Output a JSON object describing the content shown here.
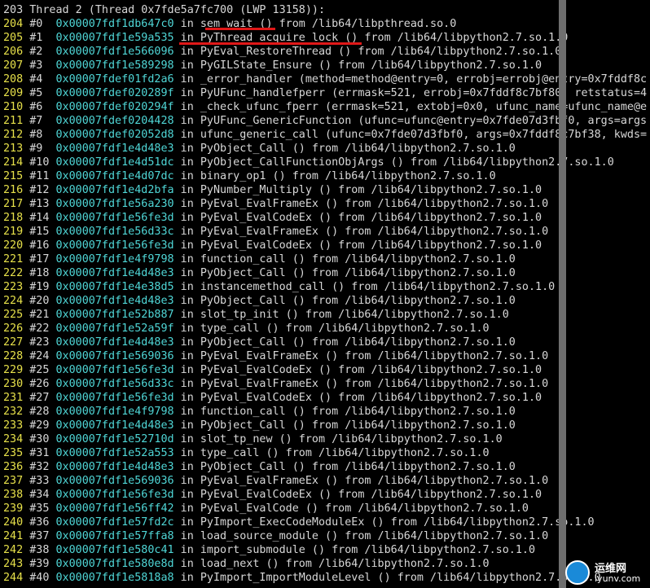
{
  "header": "203 Thread 2 (Thread 0x7fde5a7fc700 (LWP 13158)):",
  "frames": [
    {
      "ln": "204",
      "num": "#0 ",
      "addr": "0x00007fdf1db647c0",
      "rest": " in sem_wait () from /lib64/libpthread.so.0"
    },
    {
      "ln": "205",
      "num": "#1 ",
      "addr": "0x00007fdf1e59a535",
      "rest": " in PyThread_acquire_lock () from /lib64/libpython2.7.so.1.0"
    },
    {
      "ln": "206",
      "num": "#2 ",
      "addr": "0x00007fdf1e566096",
      "rest": " in PyEval_RestoreThread () from /lib64/libpython2.7.so.1.0"
    },
    {
      "ln": "207",
      "num": "#3 ",
      "addr": "0x00007fdf1e589298",
      "rest": " in PyGILState_Ensure () from /lib64/libpython2.7.so.1.0"
    },
    {
      "ln": "208",
      "num": "#4 ",
      "addr": "0x00007fdef01fd2a6",
      "rest": " in _error_handler (method=method@entry=0, errobj=errobj@entry=0x7fddf8c7"
    },
    {
      "ln": "209",
      "num": "#5 ",
      "addr": "0x00007fdef020289f",
      "rest": " in PyUFunc_handlefperr (errmask=521, errobj=0x7fddf8c7bf80, retstatus=4,"
    },
    {
      "ln": "210",
      "num": "#6 ",
      "addr": "0x00007fdef020294f",
      "rest": " in _check_ufunc_fperr (errmask=521, extobj=0x0, ufunc_name=ufunc_name@en"
    },
    {
      "ln": "211",
      "num": "#7 ",
      "addr": "0x00007fdef0204428",
      "rest": " in PyUFunc_GenericFunction (ufunc=ufunc@entry=0x7fde07d3fbf0, args=args@"
    },
    {
      "ln": "212",
      "num": "#8 ",
      "addr": "0x00007fdef02052d8",
      "rest": " in ufunc_generic_call (ufunc=0x7fde07d3fbf0, args=0x7fddf8c7bf38, kwds=0"
    },
    {
      "ln": "213",
      "num": "#9 ",
      "addr": "0x00007fdf1e4d48e3",
      "rest": " in PyObject_Call () from /lib64/libpython2.7.so.1.0"
    },
    {
      "ln": "214",
      "num": "#10",
      "addr": "0x00007fdf1e4d51dc",
      "rest": " in PyObject_CallFunctionObjArgs () from /lib64/libpython2.7.so.1.0"
    },
    {
      "ln": "215",
      "num": "#11",
      "addr": "0x00007fdf1e4d07dc",
      "rest": " in binary_op1 () from /lib64/libpython2.7.so.1.0"
    },
    {
      "ln": "216",
      "num": "#12",
      "addr": "0x00007fdf1e4d2bfa",
      "rest": " in PyNumber_Multiply () from /lib64/libpython2.7.so.1.0"
    },
    {
      "ln": "217",
      "num": "#13",
      "addr": "0x00007fdf1e56a230",
      "rest": " in PyEval_EvalFrameEx () from /lib64/libpython2.7.so.1.0"
    },
    {
      "ln": "218",
      "num": "#14",
      "addr": "0x00007fdf1e56fe3d",
      "rest": " in PyEval_EvalCodeEx () from /lib64/libpython2.7.so.1.0"
    },
    {
      "ln": "219",
      "num": "#15",
      "addr": "0x00007fdf1e56d33c",
      "rest": " in PyEval_EvalFrameEx () from /lib64/libpython2.7.so.1.0"
    },
    {
      "ln": "220",
      "num": "#16",
      "addr": "0x00007fdf1e56fe3d",
      "rest": " in PyEval_EvalCodeEx () from /lib64/libpython2.7.so.1.0"
    },
    {
      "ln": "221",
      "num": "#17",
      "addr": "0x00007fdf1e4f9798",
      "rest": " in function_call () from /lib64/libpython2.7.so.1.0"
    },
    {
      "ln": "222",
      "num": "#18",
      "addr": "0x00007fdf1e4d48e3",
      "rest": " in PyObject_Call () from /lib64/libpython2.7.so.1.0"
    },
    {
      "ln": "223",
      "num": "#19",
      "addr": "0x00007fdf1e4e38d5",
      "rest": " in instancemethod_call () from /lib64/libpython2.7.so.1.0"
    },
    {
      "ln": "224",
      "num": "#20",
      "addr": "0x00007fdf1e4d48e3",
      "rest": " in PyObject_Call () from /lib64/libpython2.7.so.1.0"
    },
    {
      "ln": "225",
      "num": "#21",
      "addr": "0x00007fdf1e52b887",
      "rest": " in slot_tp_init () from /lib64/libpython2.7.so.1.0"
    },
    {
      "ln": "226",
      "num": "#22",
      "addr": "0x00007fdf1e52a59f",
      "rest": " in type_call () from /lib64/libpython2.7.so.1.0"
    },
    {
      "ln": "227",
      "num": "#23",
      "addr": "0x00007fdf1e4d48e3",
      "rest": " in PyObject_Call () from /lib64/libpython2.7.so.1.0"
    },
    {
      "ln": "228",
      "num": "#24",
      "addr": "0x00007fdf1e569036",
      "rest": " in PyEval_EvalFrameEx () from /lib64/libpython2.7.so.1.0"
    },
    {
      "ln": "229",
      "num": "#25",
      "addr": "0x00007fdf1e56fe3d",
      "rest": " in PyEval_EvalCodeEx () from /lib64/libpython2.7.so.1.0"
    },
    {
      "ln": "230",
      "num": "#26",
      "addr": "0x00007fdf1e56d33c",
      "rest": " in PyEval_EvalFrameEx () from /lib64/libpython2.7.so.1.0"
    },
    {
      "ln": "231",
      "num": "#27",
      "addr": "0x00007fdf1e56fe3d",
      "rest": " in PyEval_EvalCodeEx () from /lib64/libpython2.7.so.1.0"
    },
    {
      "ln": "232",
      "num": "#28",
      "addr": "0x00007fdf1e4f9798",
      "rest": " in function_call () from /lib64/libpython2.7.so.1.0"
    },
    {
      "ln": "233",
      "num": "#29",
      "addr": "0x00007fdf1e4d48e3",
      "rest": " in PyObject_Call () from /lib64/libpython2.7.so.1.0"
    },
    {
      "ln": "234",
      "num": "#30",
      "addr": "0x00007fdf1e52710d",
      "rest": " in slot_tp_new () from /lib64/libpython2.7.so.1.0"
    },
    {
      "ln": "235",
      "num": "#31",
      "addr": "0x00007fdf1e52a553",
      "rest": " in type_call () from /lib64/libpython2.7.so.1.0"
    },
    {
      "ln": "236",
      "num": "#32",
      "addr": "0x00007fdf1e4d48e3",
      "rest": " in PyObject_Call () from /lib64/libpython2.7.so.1.0"
    },
    {
      "ln": "237",
      "num": "#33",
      "addr": "0x00007fdf1e569036",
      "rest": " in PyEval_EvalFrameEx () from /lib64/libpython2.7.so.1.0"
    },
    {
      "ln": "238",
      "num": "#34",
      "addr": "0x00007fdf1e56fe3d",
      "rest": " in PyEval_EvalCodeEx () from /lib64/libpython2.7.so.1.0"
    },
    {
      "ln": "239",
      "num": "#35",
      "addr": "0x00007fdf1e56ff42",
      "rest": " in PyEval_EvalCode () from /lib64/libpython2.7.so.1.0"
    },
    {
      "ln": "240",
      "num": "#36",
      "addr": "0x00007fdf1e57fd2c",
      "rest": " in PyImport_ExecCodeModuleEx () from /lib64/libpython2.7.so.1.0"
    },
    {
      "ln": "241",
      "num": "#37",
      "addr": "0x00007fdf1e57ffa8",
      "rest": " in load_source_module () from /lib64/libpython2.7.so.1.0"
    },
    {
      "ln": "242",
      "num": "#38",
      "addr": "0x00007fdf1e580c41",
      "rest": " in import_submodule () from /lib64/libpython2.7.so.1.0"
    },
    {
      "ln": "243",
      "num": "#39",
      "addr": "0x00007fdf1e580e8d",
      "rest": " in load_next () from /lib64/libpython2.7.so.1.0"
    },
    {
      "ln": "244",
      "num": "#40",
      "addr": "0x00007fdf1e5818a8",
      "rest": " in PyImport_ImportModuleLevel () from /lib64/libpython2.7.so.1.0"
    }
  ],
  "watermark": {
    "name": "运维网",
    "url": "iyunv.com"
  },
  "colors": {
    "background": "#000000",
    "line_number": "#e6e04a",
    "address": "#4fd6d6",
    "text": "#d8d8d8",
    "underline": "#e01818",
    "scrollbar": "#6e6e6e"
  }
}
